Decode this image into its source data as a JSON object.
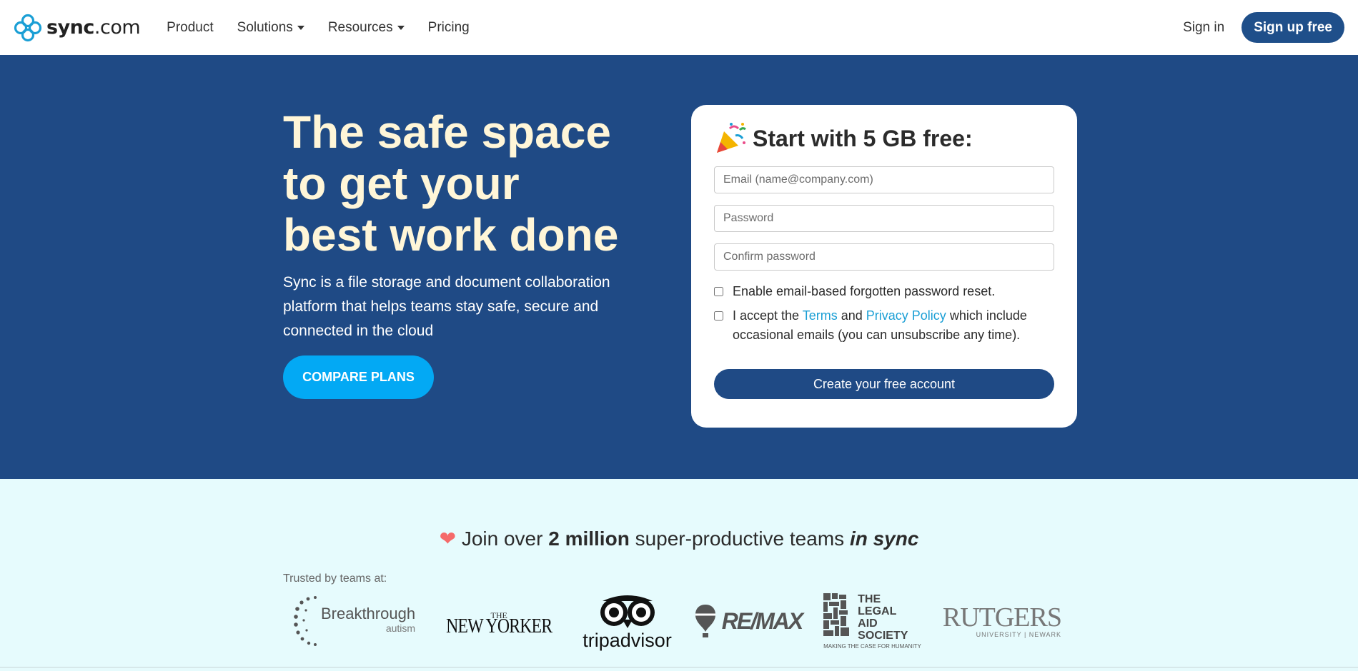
{
  "brand": {
    "name_bold": "sync",
    "name_light": ".com"
  },
  "nav": {
    "links": [
      {
        "label": "Product"
      },
      {
        "label": "Solutions"
      },
      {
        "label": "Resources"
      },
      {
        "label": "Pricing"
      }
    ],
    "signin": "Sign in",
    "signup": "Sign up free"
  },
  "hero": {
    "title": "The safe space to get your best work done",
    "subtitle": "Sync is a file storage and document collaboration platform that helps teams stay safe, secure and connected in the cloud",
    "cta": "COMPARE PLANS"
  },
  "signup_form": {
    "title": "Start with 5 GB free:",
    "email_placeholder": "Email (name@company.com)",
    "password_placeholder": "Password",
    "confirm_placeholder": "Confirm password",
    "reset_label": "Enable email-based forgotten password reset.",
    "accept_prefix": "I accept the ",
    "terms_label": "Terms",
    "accept_and": " and ",
    "privacy_label": "Privacy Policy",
    "accept_suffix": " which include occasional emails (you can unsubscribe any time).",
    "submit": "Create your free account"
  },
  "trust": {
    "join_prefix": "Join over ",
    "join_bold": "2 million",
    "join_middle": " super-productive teams ",
    "join_italic": "in sync",
    "trusted_label": "Trusted by teams at:",
    "logos": {
      "breakthrough": {
        "name": "Breakthrough",
        "sub": "autism"
      },
      "newyorker": {
        "the": "THE",
        "name": "NEW YORKER"
      },
      "tripadvisor": {
        "name": "tripadvisor"
      },
      "remax": {
        "name": "RE/MAX"
      },
      "legalaid": {
        "line1": "THE",
        "line2": "LEGAL",
        "line3": "AID",
        "line4": "SOCIETY",
        "tagline": "MAKING THE CASE FOR HUMANITY"
      },
      "rutgers": {
        "name": "RUTGERS",
        "sub": "UNIVERSITY | NEWARK"
      }
    }
  },
  "colors": {
    "brand_blue": "#1f4a85",
    "cta_blue": "#03a9f4",
    "link": "#1b9fd5",
    "heart": "#f56a6a"
  }
}
